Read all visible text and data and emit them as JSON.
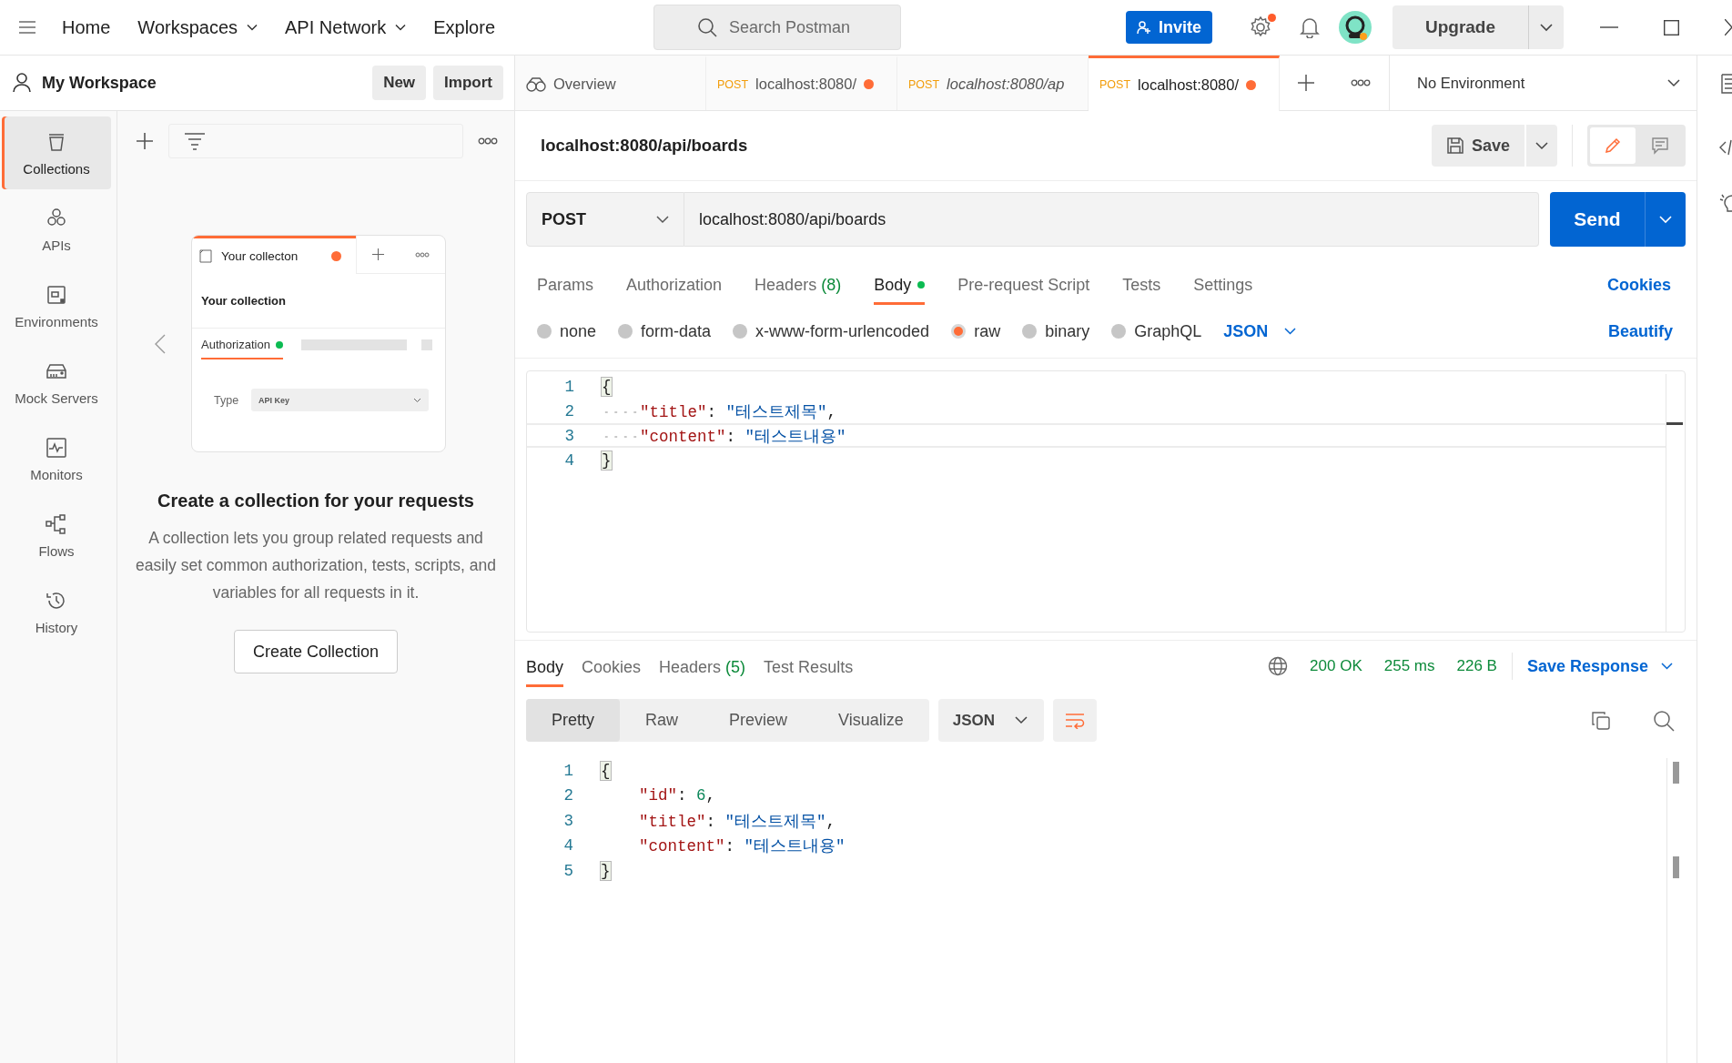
{
  "topbar": {
    "nav": [
      {
        "label": "Home",
        "dropdown": false
      },
      {
        "label": "Workspaces",
        "dropdown": true
      },
      {
        "label": "API Network",
        "dropdown": true
      },
      {
        "label": "Explore",
        "dropdown": false
      }
    ],
    "search": {
      "placeholder": "Search Postman"
    },
    "invite": "Invite",
    "settings_badge": true,
    "upgrade": "Upgrade"
  },
  "workspace": {
    "title": "My Workspace",
    "buttons": [
      "New",
      "Import"
    ]
  },
  "sidebar": {
    "items": [
      {
        "kind": "collections",
        "label": "Collections",
        "selected": true
      },
      {
        "kind": "apis",
        "label": "APIs",
        "selected": false
      },
      {
        "kind": "environments",
        "label": "Environments",
        "selected": false
      },
      {
        "kind": "mock",
        "label": "Mock Servers",
        "selected": false
      },
      {
        "kind": "monitors",
        "label": "Monitors",
        "selected": false
      },
      {
        "kind": "flows",
        "label": "Flows",
        "selected": false
      },
      {
        "kind": "history",
        "label": "History",
        "selected": false
      }
    ]
  },
  "collections_panel": {
    "illustration": {
      "tab": "Your collecton",
      "title": "Your collection",
      "section": "Authorization",
      "field_label": "Type",
      "field_value": "API Key"
    },
    "heading": "Create a collection for your requests",
    "description": "A collection lets you group related requests and easily set common authorization, tests, scripts, and variables for all requests in it.",
    "button": "Create Collection"
  },
  "tabs": [
    {
      "kind": "overview",
      "label": "Overview",
      "selected": false
    },
    {
      "kind": "request",
      "method": "POST",
      "label": "localhost:8080/",
      "italic": false,
      "unsaved": true,
      "selected": false
    },
    {
      "kind": "request",
      "method": "POST",
      "label": "localhost:8080/ap",
      "italic": true,
      "unsaved": false,
      "selected": false
    },
    {
      "kind": "request",
      "method": "POST",
      "label": "localhost:8080/",
      "italic": false,
      "unsaved": true,
      "selected": true
    }
  ],
  "environment": "No Environment",
  "request": {
    "title": "localhost:8080/api/boards",
    "save": "Save",
    "method": "POST",
    "url": "localhost:8080/api/boards",
    "send": "Send",
    "tabs": [
      {
        "label": "Params",
        "selected": false
      },
      {
        "label": "Authorization",
        "selected": false
      },
      {
        "label": "Headers",
        "count": "(8)",
        "selected": false
      },
      {
        "label": "Body",
        "has_content": true,
        "selected": true
      },
      {
        "label": "Pre-request Script",
        "selected": false
      },
      {
        "label": "Tests",
        "selected": false
      },
      {
        "label": "Settings",
        "selected": false
      }
    ],
    "cookies": "Cookies",
    "body_types": [
      {
        "label": "none",
        "selected": false
      },
      {
        "label": "form-data",
        "selected": false
      },
      {
        "label": "x-www-form-urlencoded",
        "selected": false
      },
      {
        "label": "raw",
        "selected": true
      },
      {
        "label": "binary",
        "selected": false
      },
      {
        "label": "GraphQL",
        "selected": false
      }
    ],
    "format": "JSON",
    "beautify": "Beautify",
    "editor": {
      "show_whitespace": true,
      "lines": [
        {
          "number": "1",
          "indented": false,
          "current": false,
          "tokens": [
            {
              "kind": "bracket",
              "text": "{"
            }
          ]
        },
        {
          "number": "2",
          "indented": true,
          "current": false,
          "tokens": [
            {
              "kind": "key",
              "text": "\"title\""
            },
            {
              "kind": "punct",
              "text": ": "
            },
            {
              "kind": "string",
              "text": "\"테스트제목\""
            },
            {
              "kind": "punct",
              "text": ","
            }
          ]
        },
        {
          "number": "3",
          "indented": true,
          "current": true,
          "tokens": [
            {
              "kind": "key",
              "text": "\"content\""
            },
            {
              "kind": "punct",
              "text": ": "
            },
            {
              "kind": "string",
              "text": "\"테스트내용\""
            }
          ]
        },
        {
          "number": "4",
          "indented": false,
          "current": false,
          "tokens": [
            {
              "kind": "bracket",
              "text": "}"
            }
          ]
        }
      ]
    }
  },
  "response": {
    "tabs": [
      {
        "label": "Body",
        "selected": true
      },
      {
        "label": "Cookies",
        "selected": false
      },
      {
        "label": "Headers",
        "count": "(5)",
        "selected": false
      },
      {
        "label": "Test Results",
        "selected": false
      }
    ],
    "status": "200 OK",
    "time": "255 ms",
    "size": "226 B",
    "save": "Save Response",
    "views": [
      {
        "label": "Pretty",
        "selected": true
      },
      {
        "label": "Raw",
        "selected": false
      },
      {
        "label": "Preview",
        "selected": false
      },
      {
        "label": "Visualize",
        "selected": false
      }
    ],
    "format": "JSON",
    "editor": {
      "show_whitespace": false,
      "lines": [
        {
          "number": "1",
          "indented": false,
          "current": false,
          "tokens": [
            {
              "kind": "bracket",
              "text": "{"
            }
          ]
        },
        {
          "number": "2",
          "indented": true,
          "current": false,
          "tokens": [
            {
              "kind": "key",
              "text": "\"id\""
            },
            {
              "kind": "punct",
              "text": ": "
            },
            {
              "kind": "number",
              "text": "6"
            },
            {
              "kind": "punct",
              "text": ","
            }
          ]
        },
        {
          "number": "3",
          "indented": true,
          "current": false,
          "tokens": [
            {
              "kind": "key",
              "text": "\"title\""
            },
            {
              "kind": "punct",
              "text": ": "
            },
            {
              "kind": "string",
              "text": "\"테스트제목\""
            },
            {
              "kind": "punct",
              "text": ","
            }
          ]
        },
        {
          "number": "4",
          "indented": true,
          "current": false,
          "tokens": [
            {
              "kind": "key",
              "text": "\"content\""
            },
            {
              "kind": "punct",
              "text": ": "
            },
            {
              "kind": "string",
              "text": "\"테스트내용\""
            }
          ]
        },
        {
          "number": "5",
          "indented": false,
          "current": false,
          "tokens": [
            {
              "kind": "bracket",
              "text": "}"
            }
          ]
        }
      ]
    }
  }
}
